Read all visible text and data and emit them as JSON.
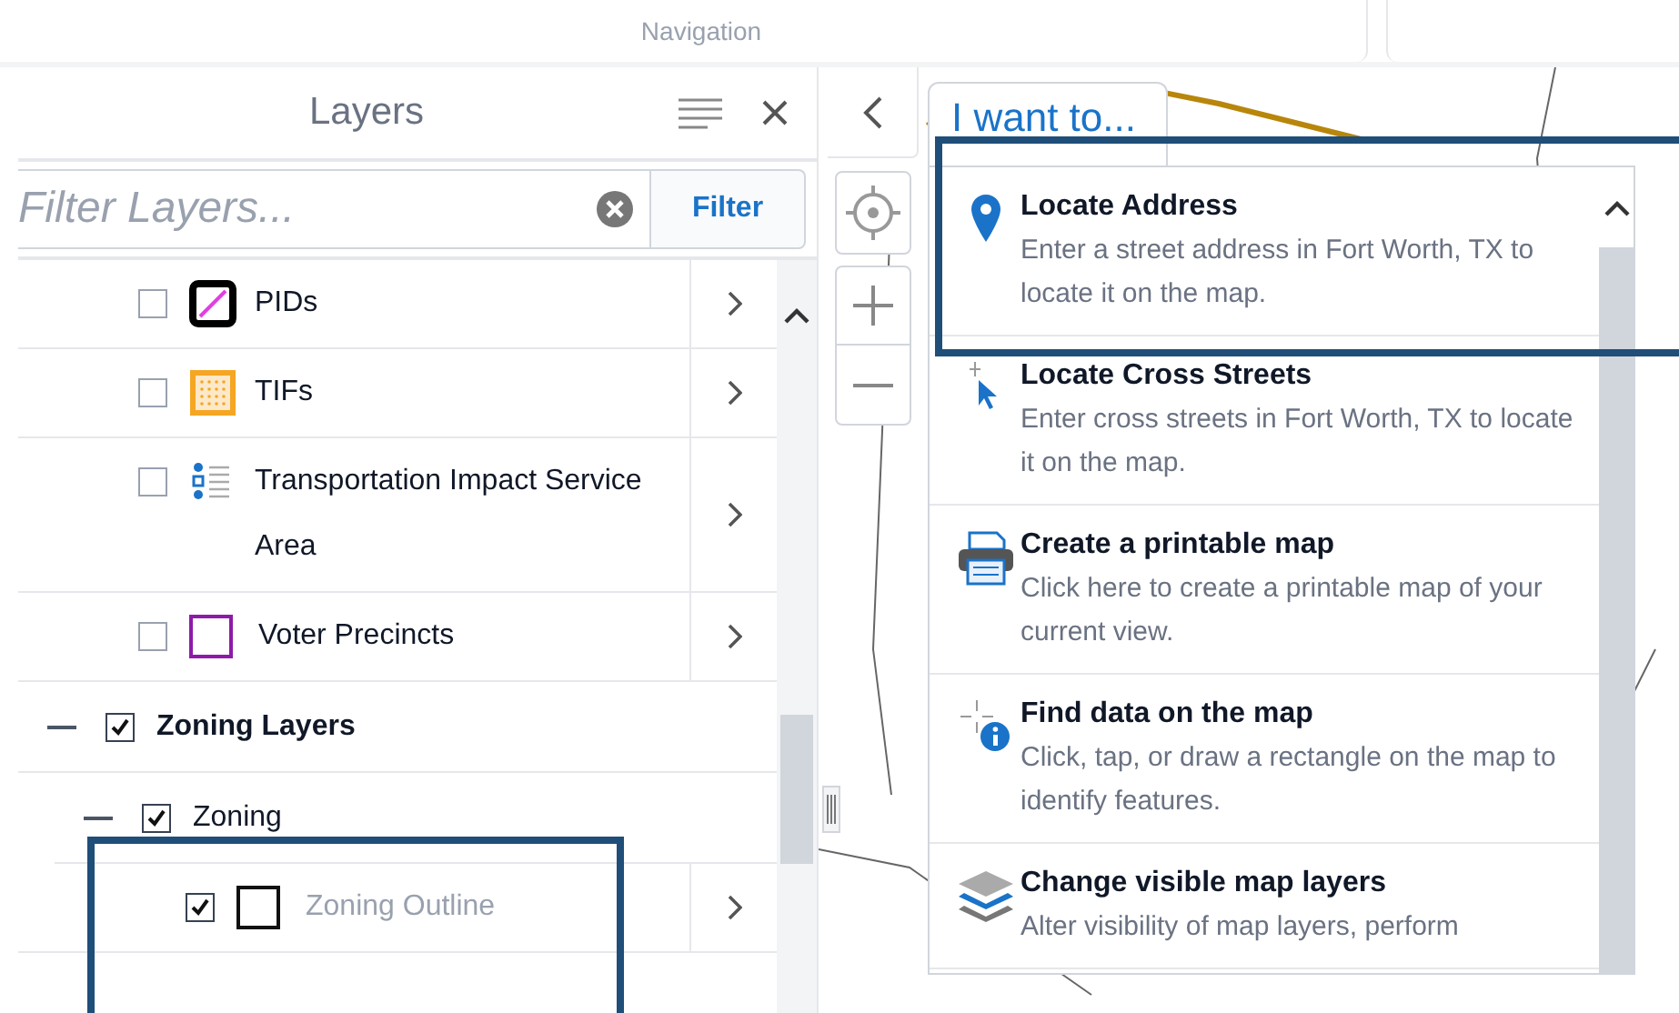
{
  "navigation": {
    "title": "Navigation"
  },
  "layers_panel": {
    "title": "Layers",
    "filter": {
      "placeholder": "Filter Layers...",
      "button": "Filter"
    },
    "layers": [
      {
        "label": "PIDs",
        "checked": false,
        "disabled": false,
        "kind": "hatched",
        "color": "#e040e0"
      },
      {
        "label": "TIFs",
        "checked": false,
        "disabled": false,
        "kind": "dotted",
        "color": "#f5a623"
      },
      {
        "label": "Transportation Impact Service Area",
        "checked": false,
        "disabled": false,
        "kind": "list",
        "color": "#1a73c8"
      },
      {
        "label": "Voter Precincts",
        "checked": false,
        "disabled": false,
        "kind": "outline",
        "color": "#8e1aa8"
      }
    ],
    "groups": [
      {
        "label": "Zoning Layers",
        "checked": true,
        "expanded": true,
        "children": [
          {
            "label": "Zoning",
            "checked": true,
            "expanded": true,
            "children": [
              {
                "label": "Zoning Outline",
                "checked": true,
                "disabled": true,
                "kind": "outline",
                "color": "#111111"
              }
            ]
          }
        ]
      }
    ]
  },
  "menu": {
    "tab": "I want to...",
    "items": [
      {
        "kind": "pin",
        "title": "Locate Address",
        "description": "Enter a street address in Fort Worth, TX to locate it on the map."
      },
      {
        "kind": "cursor",
        "title": "Locate Cross Streets",
        "description": "Enter cross streets in Fort Worth, TX to locate it on the map."
      },
      {
        "kind": "printer",
        "title": "Create a printable map",
        "description": "Click here to create a printable map of your current view."
      },
      {
        "kind": "info",
        "title": "Find data on the map",
        "description": "Click, tap, or draw a rectangle on the map to identify features."
      },
      {
        "kind": "layers",
        "title": "Change visible map layers",
        "description": "Alter visibility of map layers, perform"
      }
    ]
  }
}
